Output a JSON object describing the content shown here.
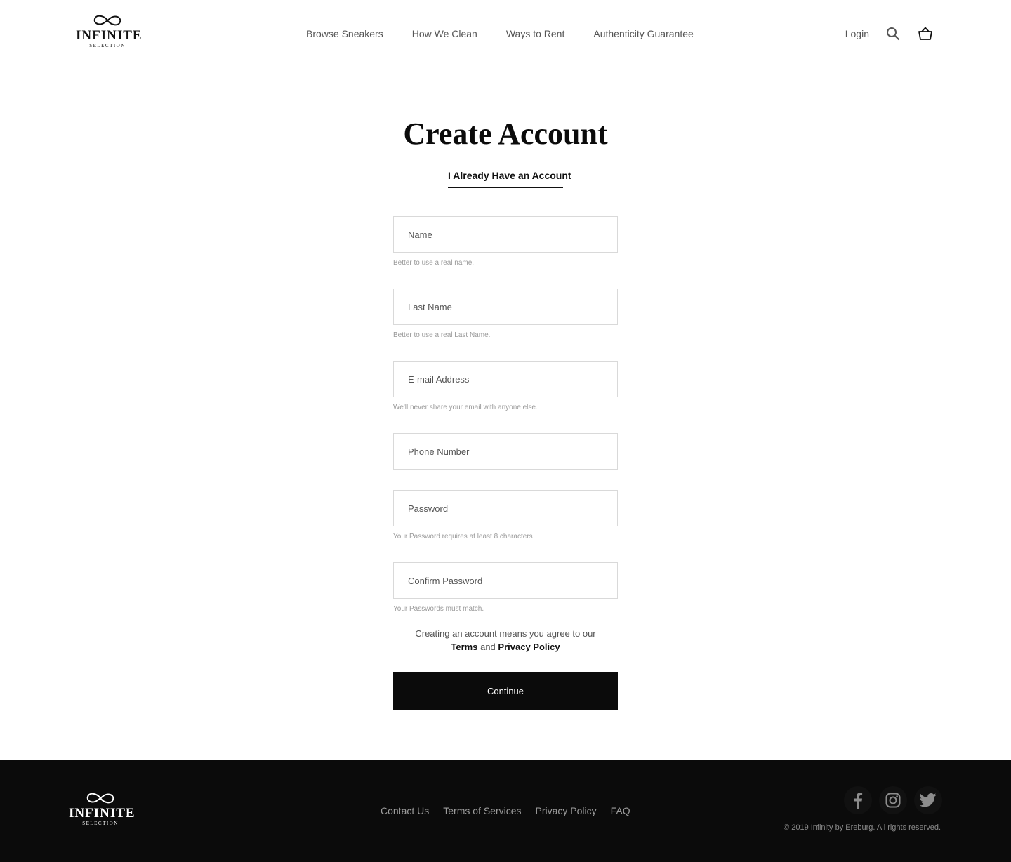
{
  "brand": {
    "name": "INFINITE",
    "tagline": "SELECTION"
  },
  "nav": {
    "items": [
      {
        "label": "Browse Sneakers"
      },
      {
        "label": "How We Clean"
      },
      {
        "label": "Ways to Rent"
      },
      {
        "label": "Authenticity Guarantee"
      }
    ],
    "login_label": "Login",
    "icons": [
      "search-icon",
      "basket-icon"
    ]
  },
  "page": {
    "title": "Create Account",
    "switch_link": "I Already Have an Account"
  },
  "form": {
    "fields": [
      {
        "placeholder": "Name",
        "hint": "Better to use a real name."
      },
      {
        "placeholder": "Last Name",
        "hint": "Better to use a real Last Name."
      },
      {
        "placeholder": "E-mail Address",
        "hint": "We'll never share your email with anyone else."
      },
      {
        "placeholder": "Phone Number",
        "hint": ""
      },
      {
        "placeholder": "Password",
        "hint": "Your Password requires at least 8 characters"
      },
      {
        "placeholder": "Confirm Password",
        "hint": "Your Passwords must match."
      }
    ],
    "agree_text": "Creating an account means you agree to our",
    "terms_label": "Terms",
    "and_label": "and",
    "privacy_label": "Privacy Policy",
    "submit_label": "Continue"
  },
  "footer": {
    "links": [
      {
        "label": "Contact Us"
      },
      {
        "label": "Terms of Services"
      },
      {
        "label": "Privacy Policy"
      },
      {
        "label": "FAQ"
      }
    ],
    "social": [
      "facebook-icon",
      "instagram-icon",
      "twitter-icon"
    ],
    "copyright": "© 2019 Infinity by Ereburg. All rights reserved."
  },
  "colors": {
    "text": "#111111",
    "muted": "#555555",
    "hint": "#9a9a9a",
    "footer_bg": "#0b0b0b",
    "button_bg": "#0b0b0b"
  }
}
